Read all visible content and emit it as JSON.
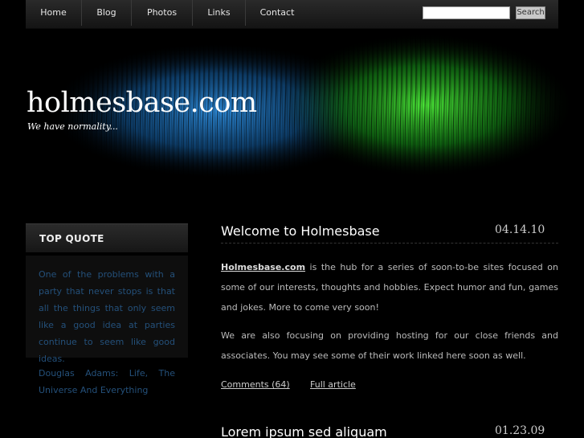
{
  "nav": {
    "items": [
      {
        "label": "Home"
      },
      {
        "label": "Blog"
      },
      {
        "label": "Photos"
      },
      {
        "label": "Links"
      },
      {
        "label": "Contact"
      }
    ],
    "search": {
      "value": "",
      "button_label": "Search"
    }
  },
  "header": {
    "title": "holmesbase.com",
    "tagline": "We have normality..."
  },
  "sidebar": {
    "title": "TOP QUOTE",
    "quote": "One of the problems with a party that never stops is that all the things that only seem like a good idea at parties continue to seem like good ideas.",
    "author_line1": "Douglas Adams: Life, The",
    "author_line2": "Universe And Everything"
  },
  "posts": [
    {
      "title": "Welcome to Holmesbase",
      "date": "04.14.10",
      "link_text": "Holmesbase.com",
      "para1_rest": " is the hub for a series of soon-to-be sites focused on some of our interests, thoughts and hobbies. Expect humor and fun, games and jokes. More to come very soon!",
      "para2": "We are also focusing on providing hosting for our close friends and associates. You may see some of their work linked here soon as well.",
      "comments_label": "Comments (64)",
      "full_article_label": "Full article"
    },
    {
      "title": "Lorem ipsum sed aliquam",
      "date": "01.23.09"
    }
  ],
  "colors": {
    "accent_blue": "#24507a",
    "banner_blue": "#1e7fd0",
    "banner_green": "#2ed12a"
  }
}
